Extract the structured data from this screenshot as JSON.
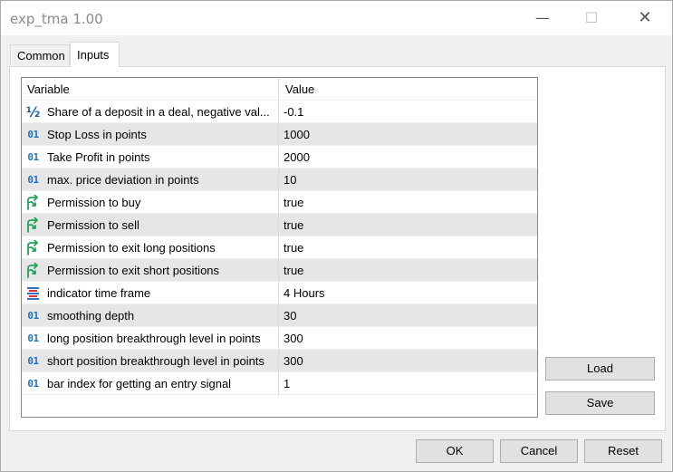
{
  "window": {
    "title": "exp_tma 1.00",
    "minimize": "—",
    "maximize": "☐",
    "close": "✕"
  },
  "tabs": [
    {
      "label": "Common"
    },
    {
      "label": "Inputs"
    }
  ],
  "grid": {
    "columns": [
      "Variable",
      "Value"
    ],
    "rows": [
      {
        "icon": "fraction-icon",
        "variable": "Share of a deposit in a deal, negative val...",
        "value": "-0.1"
      },
      {
        "icon": "integer-icon",
        "variable": "Stop Loss in points",
        "value": "1000"
      },
      {
        "icon": "integer-icon",
        "variable": "Take Profit in points",
        "value": "2000"
      },
      {
        "icon": "integer-icon",
        "variable": "max. price deviation in points",
        "value": "10"
      },
      {
        "icon": "boolean-icon",
        "variable": "Permission to buy",
        "value": "true"
      },
      {
        "icon": "boolean-icon",
        "variable": "Permission to sell",
        "value": "true"
      },
      {
        "icon": "boolean-icon",
        "variable": "Permission to exit long positions",
        "value": "true"
      },
      {
        "icon": "boolean-icon",
        "variable": "Permission to exit short positions",
        "value": "true"
      },
      {
        "icon": "enum-icon",
        "variable": "indicator time frame",
        "value": "4 Hours"
      },
      {
        "icon": "integer-icon",
        "variable": "smoothing depth",
        "value": "30"
      },
      {
        "icon": "integer-icon",
        "variable": "long position breakthrough level in points",
        "value": "300"
      },
      {
        "icon": "integer-icon",
        "variable": "short position breakthrough level in points",
        "value": "300"
      },
      {
        "icon": "integer-icon",
        "variable": "bar index for getting an entry signal",
        "value": "1"
      }
    ]
  },
  "side_buttons": {
    "load": "Load",
    "save": "Save"
  },
  "footer": {
    "ok": "OK",
    "cancel": "Cancel",
    "reset": "Reset"
  },
  "icon_glyphs": {
    "integer": "01",
    "fraction": "½"
  },
  "colors": {
    "accent_blue": "#1a73c7",
    "bool_green": "#22a35a",
    "alt_row": "#e6e6e6"
  }
}
